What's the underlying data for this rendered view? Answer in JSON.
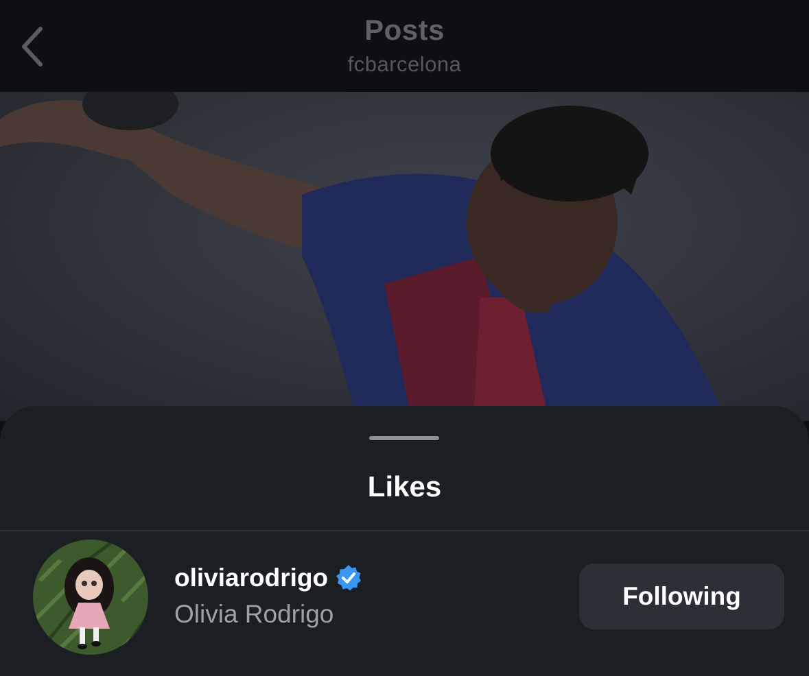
{
  "header": {
    "title": "Posts",
    "subtitle": "fcbarcelona",
    "back_icon": "chevron-left-icon"
  },
  "post": {
    "image_description_icon": "photo"
  },
  "sheet": {
    "title": "Likes"
  },
  "likes": [
    {
      "username": "oliviarodrigo",
      "full_name": "Olivia Rodrigo",
      "verified": true,
      "follow_label": "Following"
    }
  ],
  "colors": {
    "background": "#0e0f12",
    "sheet": "#1b1e22",
    "verified_badge": "#3897f0",
    "button": "#2c2f35",
    "secondary_text": "#9da1a8"
  }
}
